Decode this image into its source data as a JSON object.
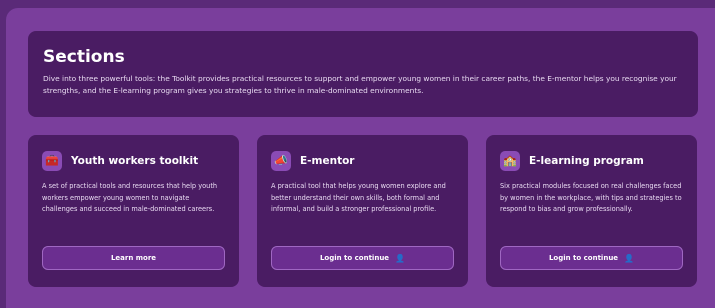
{
  "header": {
    "title": "Sections",
    "description": "Dive into three powerful tools: the Toolkit provides practical resources to support and empower young women in their career paths, the E-mentor helps you recognise your strengths, and the E-learning program gives you strategies to thrive in male-dominated environments."
  },
  "cards": [
    {
      "icon": "toolkit-icon",
      "title": "Youth workers toolkit",
      "description": "A set of practical tools and resources that help youth workers empower young women to navigate challenges and succeed in male-dominated careers.",
      "button": "Learn more"
    },
    {
      "icon": "mentor-icon",
      "title": "E-mentor",
      "description": "A practical tool that helps young women explore and better understand their own skills, both formal and informal, and build a stronger professional profile.",
      "button": "Login to continue"
    },
    {
      "icon": "elearning-icon",
      "title": "E-learning program",
      "description": "Six practical modules focused on real challenges faced by women in the workplace, with tips and strategies to respond to bias and grow professionally.",
      "button": "Login to continue"
    }
  ],
  "colors": {
    "background": "#5a2a78",
    "panel": "#7a3e9c",
    "card": "#4a1c63",
    "button": "#6b2e90"
  }
}
